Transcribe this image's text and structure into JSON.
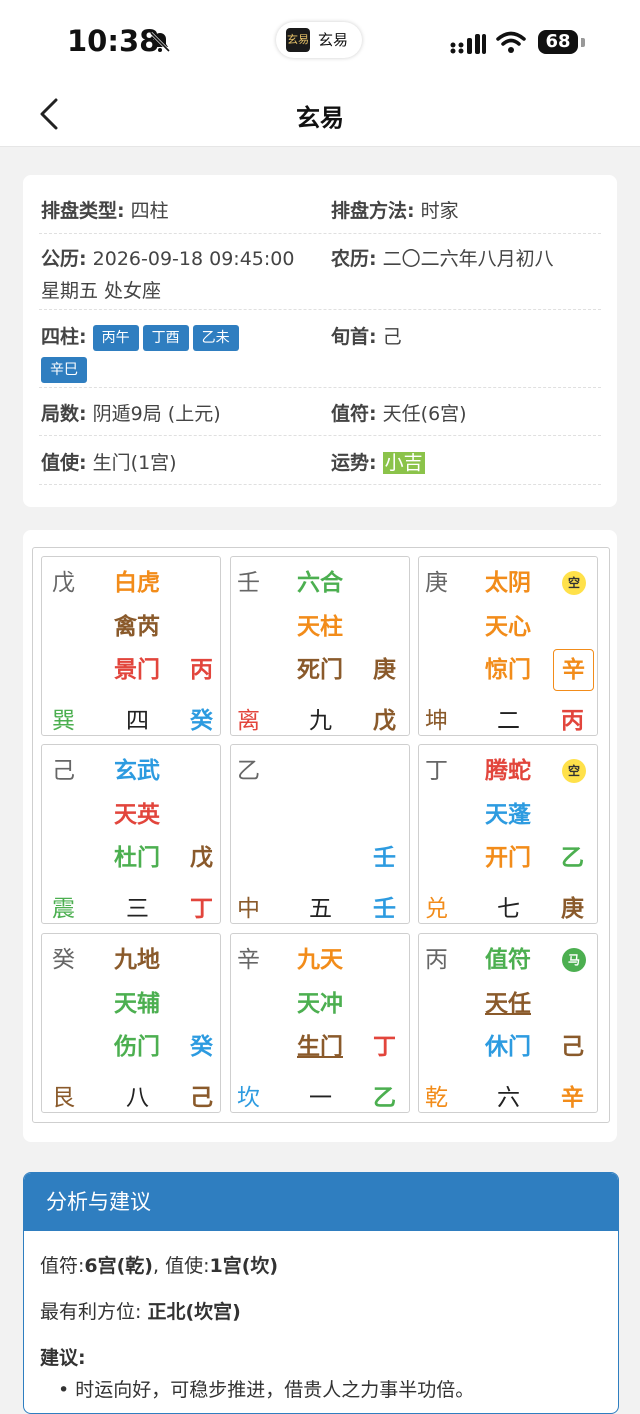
{
  "status": {
    "time": "10:38",
    "app_pill": "玄易",
    "app_logo": "玄易",
    "battery": "68"
  },
  "nav": {
    "title": "玄易"
  },
  "info": {
    "type_label": "排盘类型:",
    "type_value": "四柱",
    "method_label": "排盘方法:",
    "method_value": "时家",
    "solar_label": "公历:",
    "solar_value": "2026-09-18 09:45:00",
    "solar_extra": "星期五 处女座",
    "lunar_label": "农历:",
    "lunar_value": "二〇二六年八月初八",
    "pillars_label": "四柱:",
    "pillars": [
      "丙午",
      "丁酉",
      "乙未",
      "辛巳"
    ],
    "xunshou_label": "旬首:",
    "xunshou_value": "己",
    "ju_label": "局数:",
    "ju_value": "阴遁9局 (上元)",
    "zhifu_label": "值符:",
    "zhifu_value": "天任(6宫)",
    "zhishi_label": "值使:",
    "zhishi_value": "生门(1宫)",
    "fortune_label": "运势:",
    "fortune_value": "小吉"
  },
  "palaces": [
    {
      "tl": "戊",
      "god": "白虎",
      "star": "禽芮",
      "door": "景门",
      "right": "丙",
      "gua": "巽",
      "num": "四",
      "br": "癸"
    },
    {
      "tl": "壬",
      "god": "六合",
      "star": "天柱",
      "door": "死门",
      "right": "庚",
      "gua": "离",
      "num": "九",
      "br": "戊"
    },
    {
      "tl": "庚",
      "god": "太阴",
      "star": "天心",
      "door": "惊门",
      "right": "辛",
      "gua": "坤",
      "num": "二",
      "br": "丙",
      "badge": "空"
    },
    {
      "tl": "己",
      "god": "玄武",
      "star": "天英",
      "door": "杜门",
      "right": "戊",
      "gua": "震",
      "num": "三",
      "br": "丁"
    },
    {
      "tl": "乙",
      "right": "壬",
      "gua": "中",
      "num": "五",
      "br": "壬"
    },
    {
      "tl": "丁",
      "god": "腾蛇",
      "star": "天蓬",
      "door": "开门",
      "right": "乙",
      "gua": "兑",
      "num": "七",
      "br": "庚",
      "badge": "空"
    },
    {
      "tl": "癸",
      "god": "九地",
      "star": "天辅",
      "door": "伤门",
      "right": "癸",
      "gua": "艮",
      "num": "八",
      "br": "己"
    },
    {
      "tl": "辛",
      "god": "九天",
      "star": "天冲",
      "door": "生门",
      "right": "丁",
      "gua": "坎",
      "num": "一",
      "br": "乙"
    },
    {
      "tl": "丙",
      "god": "值符",
      "star": "天任",
      "door": "休门",
      "right": "己",
      "gua": "乾",
      "num": "六",
      "br": "辛",
      "badge": "马"
    }
  ],
  "advice": {
    "title": "分析与建议",
    "line1_a": "值符:",
    "line1_b": "6宫(乾)",
    "line1_c": ", 值使:",
    "line1_d": "1宫(坎)",
    "line2_a": "最有利方位: ",
    "line2_b": "正北(坎宫)",
    "line3": "建议:",
    "bullet1": "时运向好，可稳步推进，借贵人之力事半功倍。"
  },
  "colors": {
    "accent": "#2f7ec0",
    "fortune": "#8bc34a",
    "orange": "#f28c1a",
    "red": "#e2453c",
    "green": "#4caf50",
    "blue": "#2d9be0",
    "brown": "#8a5a2b"
  }
}
